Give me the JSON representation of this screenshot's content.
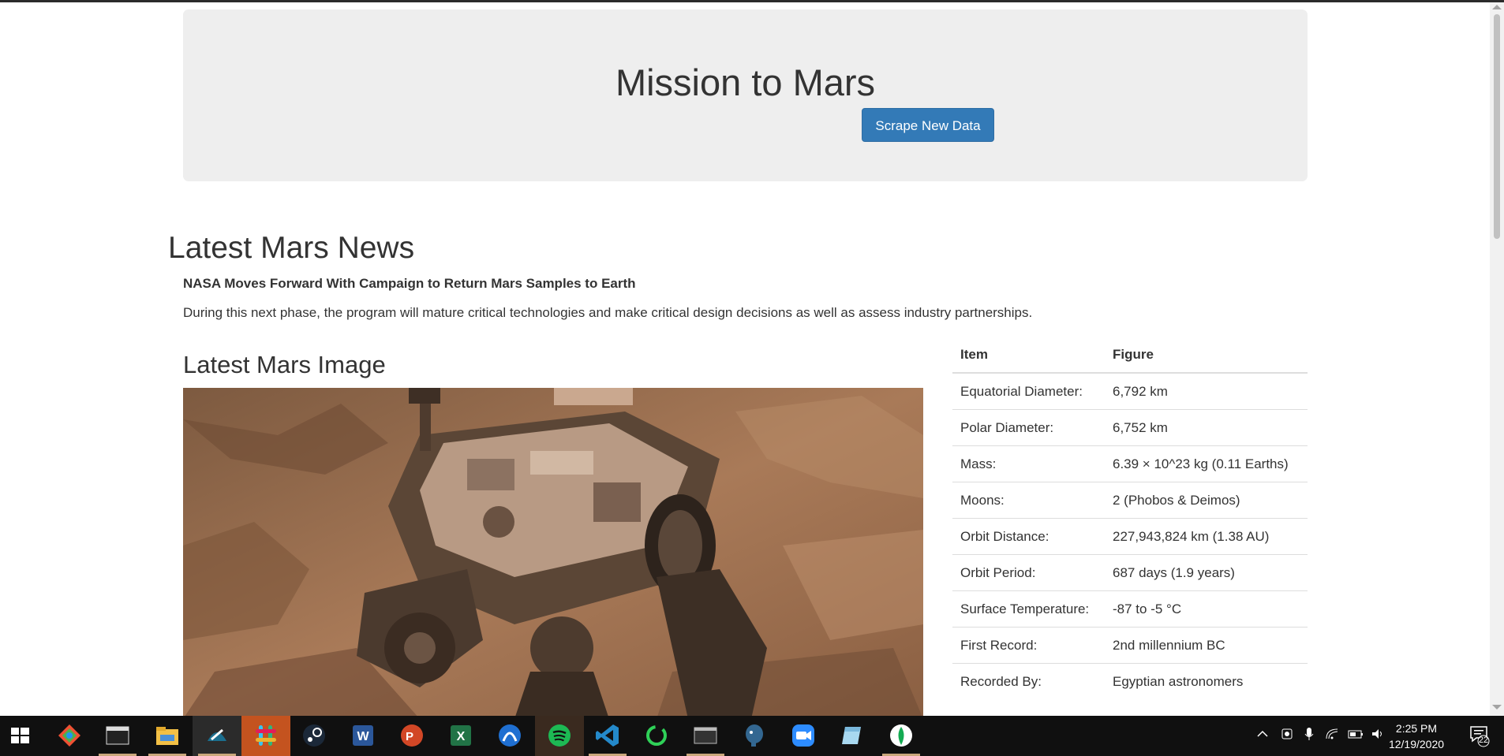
{
  "jumbotron": {
    "title": "Mission to Mars",
    "button_label": "Scrape New Data"
  },
  "news": {
    "heading": "Latest Mars News",
    "title": "NASA Moves Forward With Campaign to Return Mars Samples to Earth",
    "paragraph": "During this next phase, the program will mature critical technologies and make critical design decisions as well as assess industry partnerships."
  },
  "image_section": {
    "heading": "Latest Mars Image",
    "alt": "Mars rover on rocky terrain"
  },
  "facts": {
    "headers": [
      "Item",
      "Figure"
    ],
    "rows": [
      {
        "item": "Equatorial Diameter:",
        "figure": "6,792 km"
      },
      {
        "item": "Polar Diameter:",
        "figure": "6,752 km"
      },
      {
        "item": "Mass:",
        "figure": "6.39 × 10^23 kg (0.11 Earths)"
      },
      {
        "item": "Moons:",
        "figure": "2 (Phobos & Deimos)"
      },
      {
        "item": "Orbit Distance:",
        "figure": "227,943,824 km (1.38 AU)"
      },
      {
        "item": "Orbit Period:",
        "figure": "687 days (1.9 years)"
      },
      {
        "item": "Surface Temperature:",
        "figure": "-87 to -5 °C"
      },
      {
        "item": "First Record:",
        "figure": "2nd millennium BC"
      },
      {
        "item": "Recorded By:",
        "figure": "Egyptian astronomers"
      }
    ]
  },
  "taskbar": {
    "icons": [
      "windows-start-icon",
      "git-icon",
      "terminal-icon",
      "file-explorer-icon",
      "mysql-workbench-icon",
      "slack-icon",
      "steam-icon",
      "word-icon",
      "powerpoint-icon",
      "excel-icon",
      "arc-app-icon",
      "spotify-icon",
      "vscode-icon",
      "loader-app-icon",
      "cmd-icon",
      "postgres-icon",
      "zoom-icon",
      "notes-icon",
      "mongodb-icon"
    ],
    "time": "2:25 PM",
    "date": "12/19/2020",
    "notification_count": "22"
  }
}
